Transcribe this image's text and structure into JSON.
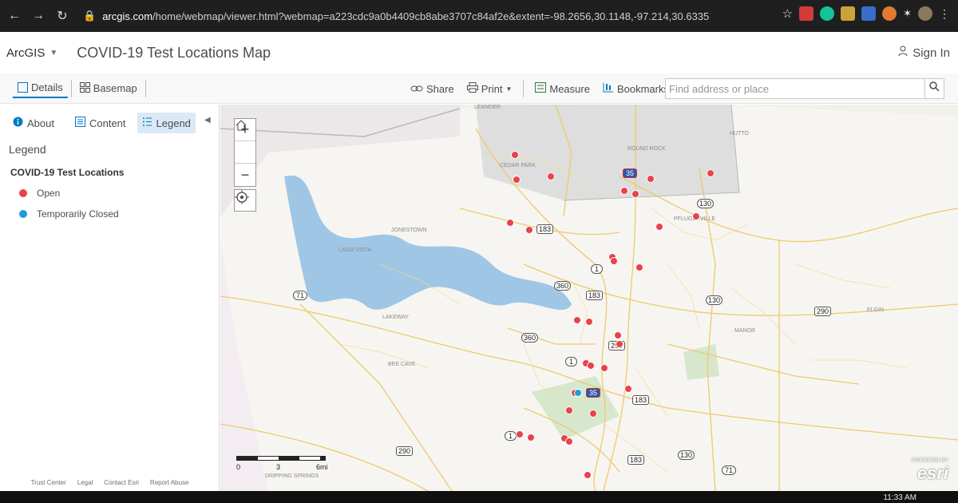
{
  "browser": {
    "url_host": "arcgis.com",
    "url_path": "/home/webmap/viewer.html?webmap=a223cdc9a0b4409cb8abe3707c84af2e&extent=-98.2656,30.1148,-97.214,30.6335"
  },
  "header": {
    "brand": "ArcGIS",
    "title": "COVID-19 Test Locations Map",
    "sign_in": "Sign In"
  },
  "toolbar": {
    "details": "Details",
    "basemap": "Basemap",
    "share": "Share",
    "print": "Print",
    "measure": "Measure",
    "bookmarks": "Bookmarks",
    "search_placeholder": "Find address or place"
  },
  "sidebar": {
    "tabs": [
      {
        "label": "About"
      },
      {
        "label": "Content"
      },
      {
        "label": "Legend"
      }
    ],
    "legend_heading": "Legend",
    "layer_name": "COVID-19 Test Locations",
    "legend_items": [
      {
        "label": "Open",
        "color": "#e8434a"
      },
      {
        "label": "Temporarily Closed",
        "color": "#1c9dd9"
      }
    ],
    "footer": [
      "Trust Center",
      "Legal",
      "Contact Esri",
      "Report Abuse"
    ]
  },
  "map": {
    "place_labels": [
      "LEANDER",
      "ROUND ROCK",
      "CEDAR PARK",
      "HUTTO",
      "PFLUGERVILLE",
      "JONESTOWN",
      "LAGO VISTA",
      "LAKEWAY",
      "BEE CAVE",
      "ELGIN",
      "MANOR",
      "DRIPPING SPRINGS"
    ],
    "highway_shields": [
      "183",
      "35",
      "130",
      "1",
      "360",
      "71",
      "290",
      "183",
      "130",
      "360",
      "290",
      "1",
      "183",
      "183",
      "1",
      "290",
      "130",
      "71",
      "35"
    ],
    "scale_labels": [
      "0",
      "3",
      "6mi"
    ],
    "attribution": "esri",
    "powered_by": "POWERED BY"
  },
  "taskbar": {
    "clock": "11:33 AM"
  }
}
